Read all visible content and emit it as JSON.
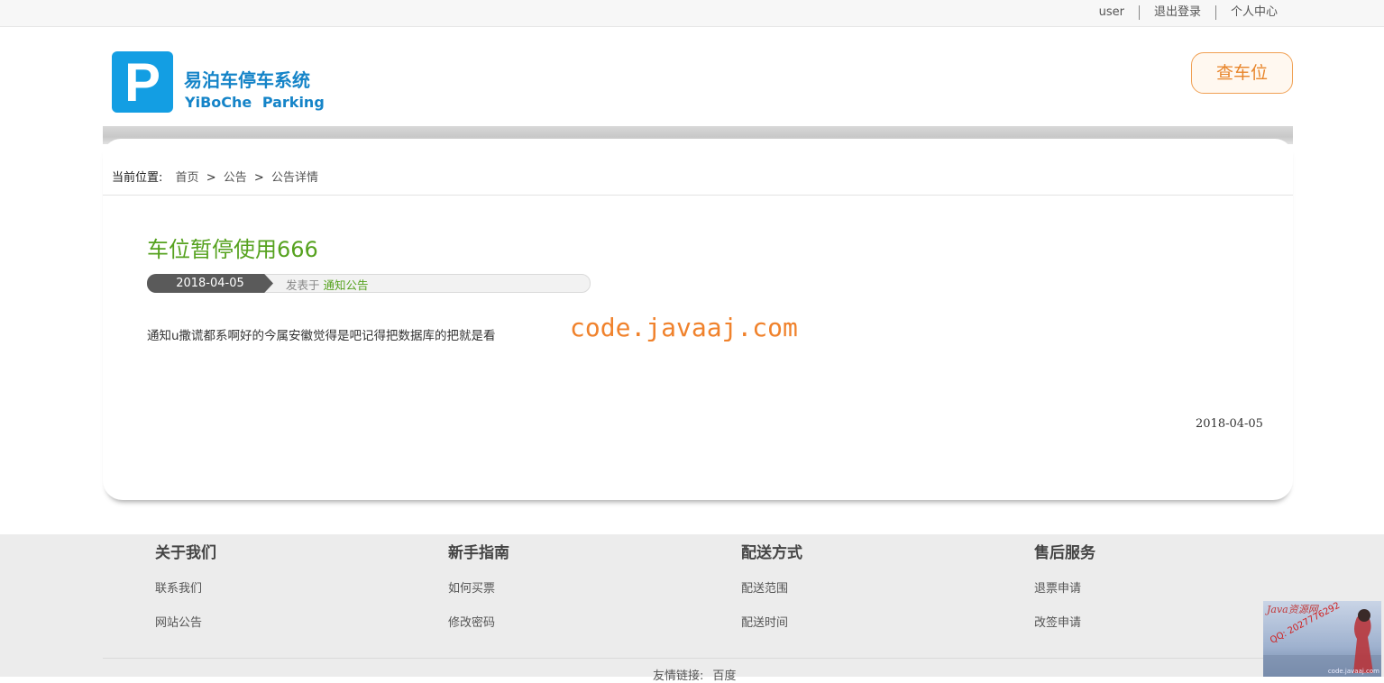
{
  "topbar": {
    "username": "user",
    "logout": "退出登录",
    "profile": "个人中心"
  },
  "header": {
    "logo_letter": "P",
    "logo_cn": "易泊车停车系统",
    "logo_en": "YiBoChe Parking",
    "find_spot": "查车位"
  },
  "breadcrumb": {
    "label": "当前位置:",
    "items": [
      "首页",
      "公告",
      "公告详情"
    ],
    "separator": ">"
  },
  "article": {
    "title": "车位暂停使用666",
    "date": "2018-04-05",
    "posted_in": "发表于",
    "category": "通知公告",
    "body": "通知u撒谎都系啊好的今属安徽觉得是吧记得把数据库的把就是看",
    "footer_date": "2018-04-05"
  },
  "watermark": "code.javaaj.com",
  "footer": {
    "columns": [
      {
        "title": "关于我们",
        "items": [
          "联系我们",
          "网站公告"
        ]
      },
      {
        "title": "新手指南",
        "items": [
          "如何买票",
          "修改密码"
        ]
      },
      {
        "title": "配送方式",
        "items": [
          "配送范围",
          "配送时间"
        ]
      },
      {
        "title": "售后服务",
        "items": [
          "退票申请",
          "改签申请"
        ]
      }
    ],
    "friend_label": "友情链接:",
    "friend_links": [
      "百度"
    ]
  },
  "corner_ad": {
    "title": "Java资源网",
    "qq": "QQ: 2027776292",
    "site": "code.javaaj.com"
  },
  "colors": {
    "logo_blue": "#139ee3",
    "title_green": "#56a21f",
    "accent_orange": "#e8852a"
  }
}
